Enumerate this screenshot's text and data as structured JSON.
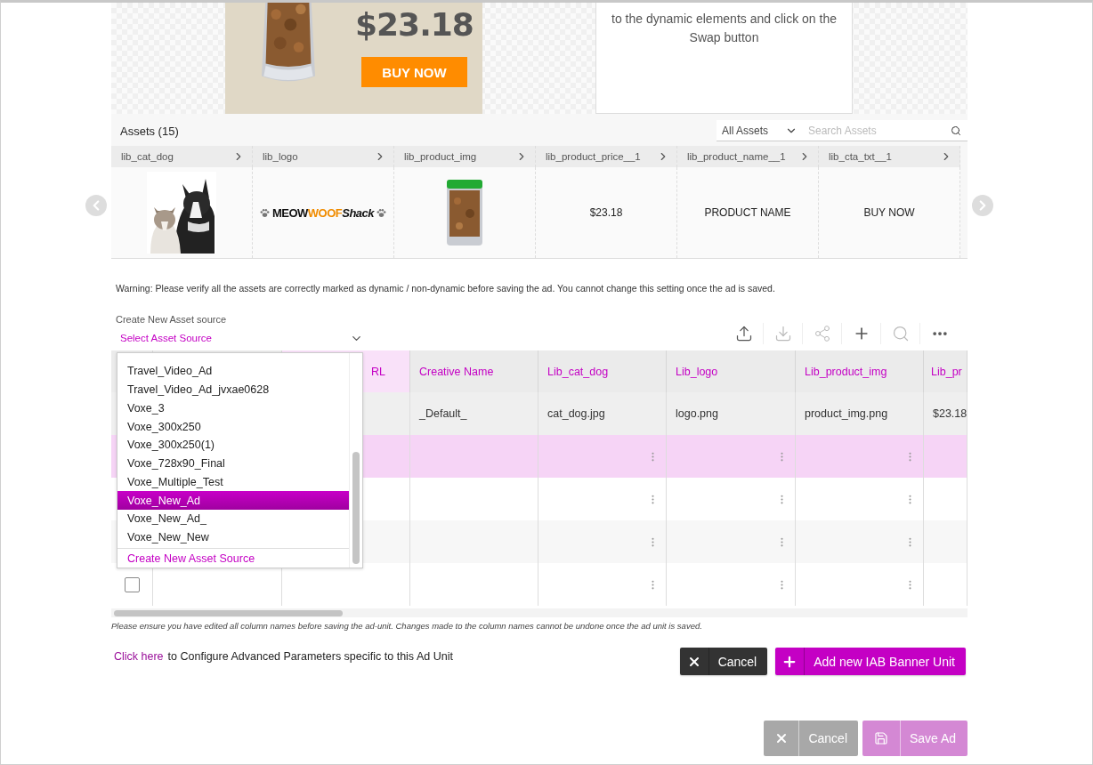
{
  "preview": {
    "price": "$23.18",
    "cta": "BUY NOW",
    "instructions": "to the dynamic elements and click on the Swap button"
  },
  "assets": {
    "title": "Assets (15)",
    "filter": "All Assets",
    "search_placeholder": "Search Assets",
    "columns": [
      {
        "name": "lib_cat_dog",
        "kind": "pets"
      },
      {
        "name": "lib_logo",
        "kind": "logo",
        "logo": [
          "MEOW",
          "WOOF",
          "Shack"
        ]
      },
      {
        "name": "lib_product_img",
        "kind": "bag"
      },
      {
        "name": "lib_product_price__1",
        "kind": "text",
        "value": "$23.18"
      },
      {
        "name": "lib_product_name__1",
        "kind": "text",
        "value": "PRODUCT NAME"
      },
      {
        "name": "lib_cta_txt__1",
        "kind": "text",
        "value": "BUY NOW"
      }
    ]
  },
  "warning": "Warning: Please verify all the assets are correctly marked as dynamic / non-dynamic before saving the ad. You cannot change this setting once the ad is saved.",
  "source": {
    "label": "Create New Asset source",
    "placeholder": "Select Asset Source",
    "options": [
      {
        "label": "Travel_Video_Ad",
        "selected": false
      },
      {
        "label": "Travel_Video_Ad_jvxae0628",
        "selected": false
      },
      {
        "label": "Voxe_3",
        "selected": false
      },
      {
        "label": "Voxe_300x250",
        "selected": false
      },
      {
        "label": "Voxe_300x250(1)",
        "selected": false
      },
      {
        "label": "Voxe_728x90_Final",
        "selected": false
      },
      {
        "label": "Voxe_Multiple_Test",
        "selected": false
      },
      {
        "label": "Voxe_New_Ad",
        "selected": true
      },
      {
        "label": "Voxe_New_Ad_",
        "selected": false
      },
      {
        "label": "Voxe_New_New",
        "selected": false
      }
    ],
    "create_action": "Create New Asset Source"
  },
  "toolbar": [
    {
      "kind": "upload",
      "disabled": false
    },
    {
      "kind": "download",
      "disabled": true
    },
    {
      "kind": "network",
      "disabled": true
    },
    {
      "kind": "add",
      "disabled": false
    },
    {
      "kind": "search",
      "disabled": true
    },
    {
      "kind": "more",
      "disabled": false
    }
  ],
  "table": {
    "columns": [
      {
        "label": "RL",
        "highlighted": true,
        "has_menu": false
      },
      {
        "label": "Creative Name",
        "highlighted": false,
        "has_menu": false
      },
      {
        "label": "Lib_cat_dog",
        "highlighted": false,
        "has_menu": true
      },
      {
        "label": "Lib_logo",
        "highlighted": false,
        "has_menu": true
      },
      {
        "label": "Lib_product_img",
        "highlighted": false,
        "has_menu": true
      },
      {
        "label": "Lib_pr",
        "highlighted": false,
        "has_menu": false
      }
    ],
    "rows": [
      {
        "selected": false,
        "cells": [
          null,
          "_Default_",
          "cat_dog.jpg",
          "logo.png",
          "product_img.png",
          "$23.18"
        ]
      },
      {
        "selected": true,
        "cells": [
          null,
          null,
          null,
          null,
          null,
          null
        ]
      },
      {
        "selected": false,
        "cells": [
          null,
          null,
          null,
          null,
          null,
          null
        ]
      },
      {
        "selected": false,
        "cells": [
          null,
          null,
          null,
          null,
          null,
          null
        ]
      },
      {
        "selected": false,
        "checked": false,
        "cells": [
          null,
          null,
          null,
          null,
          null,
          null
        ]
      }
    ]
  },
  "note": "Please ensure you have edited all column names before saving the ad-unit. Changes made to the column names cannot be undone once the ad unit is saved.",
  "advanced": {
    "link": "Click here",
    "text": "to Configure Advanced Parameters specific to this Ad Unit"
  },
  "unit_buttons": [
    {
      "label": "Cancel",
      "kind": "cancel",
      "disabled": false
    },
    {
      "label": "Add new IAB Banner Unit",
      "kind": "add",
      "disabled": false
    }
  ],
  "footer_buttons": [
    {
      "label": "Cancel",
      "kind": "cancel",
      "disabled": true
    },
    {
      "label": "Save Ad",
      "kind": "save",
      "disabled": true
    }
  ]
}
